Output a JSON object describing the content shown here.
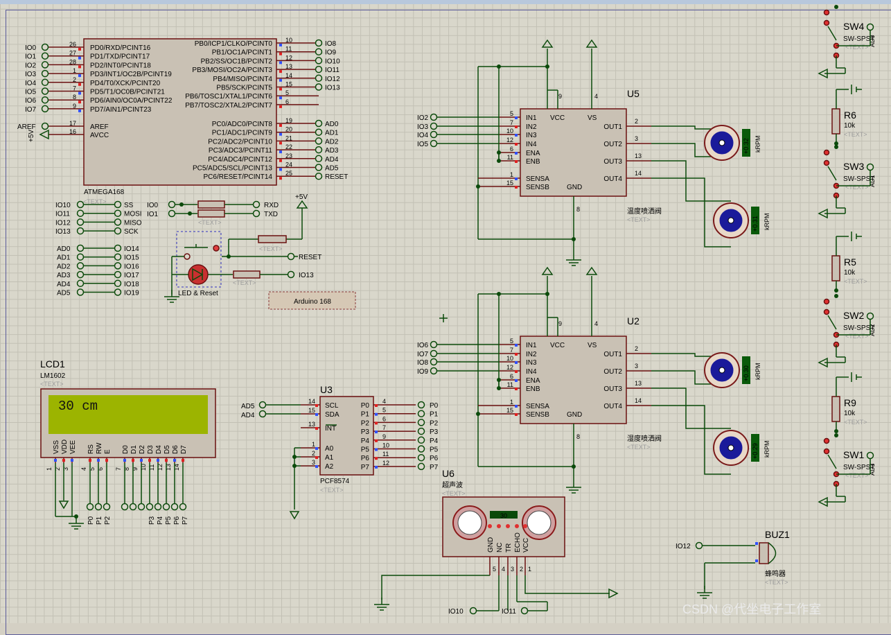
{
  "watermark": "CSDN @代坐电子工作室",
  "mcu": {
    "ref": "ATMEGA168",
    "left_pins": [
      {
        "net": "IO0",
        "num": "26",
        "name": "PD0/RXD/PCINT16"
      },
      {
        "net": "IO1",
        "num": "27",
        "name": "PD1/TXD/PCINT17"
      },
      {
        "net": "IO2",
        "num": "28",
        "name": "PD2/INT0/PCINT18"
      },
      {
        "net": "IO3",
        "num": "1",
        "name": "PD3/INT1/OC2B/PCINT19"
      },
      {
        "net": "IO4",
        "num": "2",
        "name": "PD4/T0/XCK/PCINT20"
      },
      {
        "net": "IO5",
        "num": "7",
        "name": "PD5/T1/OC0B/PCINT21"
      },
      {
        "net": "IO6",
        "num": "8",
        "name": "PD6/AIN0/OC0A/PCINT22"
      },
      {
        "net": "IO7",
        "num": "9",
        "name": "PD7/AIN1/PCINT23"
      }
    ],
    "aref": {
      "net": "AREF",
      "num": "17",
      "name": "AREF"
    },
    "avcc": {
      "net": "+5V",
      "num": "16",
      "name": "AVCC"
    },
    "right_pins": [
      {
        "net": "IO8",
        "num": "10",
        "name": "PB0/ICP1/CLKO/PCINT0"
      },
      {
        "net": "IO9",
        "num": "11",
        "name": "PB1/OC1A/PCINT1"
      },
      {
        "net": "IO10",
        "num": "12",
        "name": "PB2/SS/OC1B/PCINT2"
      },
      {
        "net": "IO11",
        "num": "13",
        "name": "PB3/MOSI/OC2A/PCINT3"
      },
      {
        "net": "IO12",
        "num": "14",
        "name": "PB4/MISO/PCINT4"
      },
      {
        "net": "IO13",
        "num": "15",
        "name": "PB5/SCK/PCINT5"
      },
      {
        "net": "",
        "num": "5",
        "name": "PB6/TOSC1/XTAL1/PCINT6"
      },
      {
        "net": "",
        "num": "6",
        "name": "PB7/TOSC2/XTAL2/PCINT7"
      }
    ],
    "right_pins2": [
      {
        "net": "AD0",
        "num": "19",
        "name": "PC0/ADC0/PCINT8"
      },
      {
        "net": "AD1",
        "num": "20",
        "name": "PC1/ADC1/PCINT9"
      },
      {
        "net": "AD2",
        "num": "21",
        "name": "PC2/ADC2/PCINT10"
      },
      {
        "net": "AD3",
        "num": "22",
        "name": "PC3/ADC3/PCINT11"
      },
      {
        "net": "AD4",
        "num": "23",
        "name": "PC4/ADC4/PCINT12"
      },
      {
        "net": "AD5",
        "num": "24",
        "name": "PC5/ADC5/SCL/PCINT13"
      },
      {
        "net": "RESET",
        "num": "25",
        "name": "PC6/RESET/PCINT14"
      }
    ]
  },
  "spi_map": [
    {
      "from": "IO10",
      "to": "SS"
    },
    {
      "from": "IO11",
      "to": "MOSI"
    },
    {
      "from": "IO12",
      "to": "MISO"
    },
    {
      "from": "IO13",
      "to": "SCK"
    }
  ],
  "adc_map": [
    {
      "from": "AD0",
      "to": "IO14"
    },
    {
      "from": "AD1",
      "to": "IO15"
    },
    {
      "from": "AD2",
      "to": "IO16"
    },
    {
      "from": "AD3",
      "to": "IO17"
    },
    {
      "from": "AD4",
      "to": "IO18"
    },
    {
      "from": "AD5",
      "to": "IO19"
    }
  ],
  "uart": {
    "io0": "IO0",
    "io1": "IO1",
    "rxd": "RXD",
    "txd": "TXD",
    "text": "<TEXT>"
  },
  "reset_block": {
    "vcc": "+5V",
    "reset": "RESET",
    "io13": "IO13",
    "label": "LED & Reset",
    "text": "<TEXT>"
  },
  "board_label": "Arduino 168",
  "lcd": {
    "ref": "LCD1",
    "model": "LM1602",
    "text": "<TEXT>",
    "display": "30 cm",
    "pins": [
      {
        "num": "1",
        "name": "VSS"
      },
      {
        "num": "2",
        "name": "VDD"
      },
      {
        "num": "3",
        "name": "VEE"
      },
      {
        "num": "4",
        "name": "RS"
      },
      {
        "num": "5",
        "name": "RW"
      },
      {
        "num": "6",
        "name": "E"
      },
      {
        "num": "7",
        "name": "D0"
      },
      {
        "num": "8",
        "name": "D1"
      },
      {
        "num": "9",
        "name": "D2"
      },
      {
        "num": "10",
        "name": "D3"
      },
      {
        "num": "11",
        "name": "D4"
      },
      {
        "num": "12",
        "name": "D5"
      },
      {
        "num": "13",
        "name": "D6"
      },
      {
        "num": "14",
        "name": "D7"
      }
    ],
    "nets": [
      "P0",
      "P1",
      "P2",
      "P3",
      "P4",
      "P5",
      "P6",
      "P7"
    ]
  },
  "pcf": {
    "ref": "U3",
    "model": "PCF8574",
    "text": "<TEXT>",
    "left": [
      {
        "net": "AD5",
        "num": "14",
        "name": "SCL"
      },
      {
        "net": "AD4",
        "num": "15",
        "name": "SDA"
      },
      {
        "net": "",
        "num": "13",
        "name": "INT"
      },
      {
        "net": "",
        "num": "1",
        "name": "A0"
      },
      {
        "net": "",
        "num": "2",
        "name": "A1"
      },
      {
        "net": "",
        "num": "3",
        "name": "A2"
      }
    ],
    "right": [
      {
        "net": "P0",
        "num": "4",
        "name": "P0"
      },
      {
        "net": "P1",
        "num": "5",
        "name": "P1"
      },
      {
        "net": "P2",
        "num": "6",
        "name": "P2"
      },
      {
        "net": "P3",
        "num": "7",
        "name": "P3"
      },
      {
        "net": "P4",
        "num": "9",
        "name": "P4"
      },
      {
        "net": "P5",
        "num": "10",
        "name": "P5"
      },
      {
        "net": "P6",
        "num": "11",
        "name": "P6"
      },
      {
        "net": "P7",
        "num": "12",
        "name": "P7"
      }
    ]
  },
  "drivers": [
    {
      "ref": "U5",
      "desc": "温度喷洒阀",
      "text": "<TEXT>",
      "inputs": [
        {
          "net": "IO2",
          "num": "5",
          "name": "IN1"
        },
        {
          "net": "IO3",
          "num": "7",
          "name": "IN2"
        },
        {
          "net": "IO4",
          "num": "10",
          "name": "IN3"
        },
        {
          "net": "IO5",
          "num": "12",
          "name": "IN4"
        },
        {
          "net": "",
          "num": "6",
          "name": "ENA"
        },
        {
          "net": "",
          "num": "11",
          "name": "ENB"
        }
      ],
      "sense": [
        {
          "num": "1",
          "name": "SENSA"
        },
        {
          "num": "15",
          "name": "SENSB"
        }
      ],
      "outputs": [
        {
          "num": "2",
          "name": "OUT1"
        },
        {
          "num": "3",
          "name": "OUT2"
        },
        {
          "num": "13",
          "name": "OUT3"
        },
        {
          "num": "14",
          "name": "OUT4"
        }
      ],
      "vcc": {
        "num": "9",
        "name": "VCC"
      },
      "vs": {
        "num": "4",
        "name": "VS"
      },
      "gnd": {
        "num": "8",
        "name": "GND"
      },
      "motors": [
        {
          "rpm": "+0.32",
          "unit": "kRPM"
        },
        {
          "rpm": "+0.31",
          "unit": "kRPM"
        }
      ]
    },
    {
      "ref": "U2",
      "desc": "湿度喷洒阀",
      "text": "<TEXT>",
      "inputs": [
        {
          "net": "IO6",
          "num": "5",
          "name": "IN1"
        },
        {
          "net": "IO7",
          "num": "7",
          "name": "IN2"
        },
        {
          "net": "IO8",
          "num": "10",
          "name": "IN3"
        },
        {
          "net": "IO9",
          "num": "12",
          "name": "IN4"
        },
        {
          "net": "",
          "num": "6",
          "name": "ENA"
        },
        {
          "net": "",
          "num": "11",
          "name": "ENB"
        }
      ],
      "sense": [
        {
          "num": "1",
          "name": "SENSA"
        },
        {
          "num": "15",
          "name": "SENSB"
        }
      ],
      "outputs": [
        {
          "num": "2",
          "name": "OUT1"
        },
        {
          "num": "3",
          "name": "OUT2"
        },
        {
          "num": "13",
          "name": "OUT3"
        },
        {
          "num": "14",
          "name": "OUT4"
        }
      ],
      "vcc": {
        "num": "9",
        "name": "VCC"
      },
      "vs": {
        "num": "4",
        "name": "VS"
      },
      "gnd": {
        "num": "8",
        "name": "GND"
      },
      "motors": [
        {
          "rpm": "+0.30",
          "unit": "kRPM"
        },
        {
          "rpm": "+0.29",
          "unit": "kRPM"
        }
      ]
    }
  ],
  "ultrasonic": {
    "ref": "U6",
    "desc": "超声波",
    "text": "<TEXT>",
    "reading": "30",
    "pins": [
      {
        "num": "5",
        "name": "GND"
      },
      {
        "num": "4",
        "name": "NC"
      },
      {
        "num": "3",
        "name": "TR"
      },
      {
        "num": "2",
        "name": "ECHO"
      },
      {
        "num": "1",
        "name": "VCC"
      }
    ],
    "io10": "IO10",
    "io11": "IO11"
  },
  "switches": [
    {
      "ref": "SW4",
      "model": "SW-SPST",
      "text": "<TEXT>"
    },
    {
      "ref": "SW3",
      "model": "SW-SPST",
      "text": "<TEXT>"
    },
    {
      "ref": "SW2",
      "model": "SW-SPST",
      "text": "<TEXT>"
    },
    {
      "ref": "SW1",
      "model": "SW-SPST",
      "text": "<TEXT>"
    }
  ],
  "resistors": [
    {
      "ref": "R6",
      "value": "10k",
      "text": "<TEXT>"
    },
    {
      "ref": "R5",
      "value": "10k",
      "text": "<TEXT>"
    },
    {
      "ref": "R9",
      "value": "10k",
      "text": "<TEXT>"
    }
  ],
  "switch_nets": [
    "AD0",
    "AD1",
    "AD2",
    "AD3"
  ],
  "buzzer": {
    "ref": "BUZ1",
    "desc": "蜂鸣器",
    "text": "<TEXT>",
    "net": "IO12"
  }
}
